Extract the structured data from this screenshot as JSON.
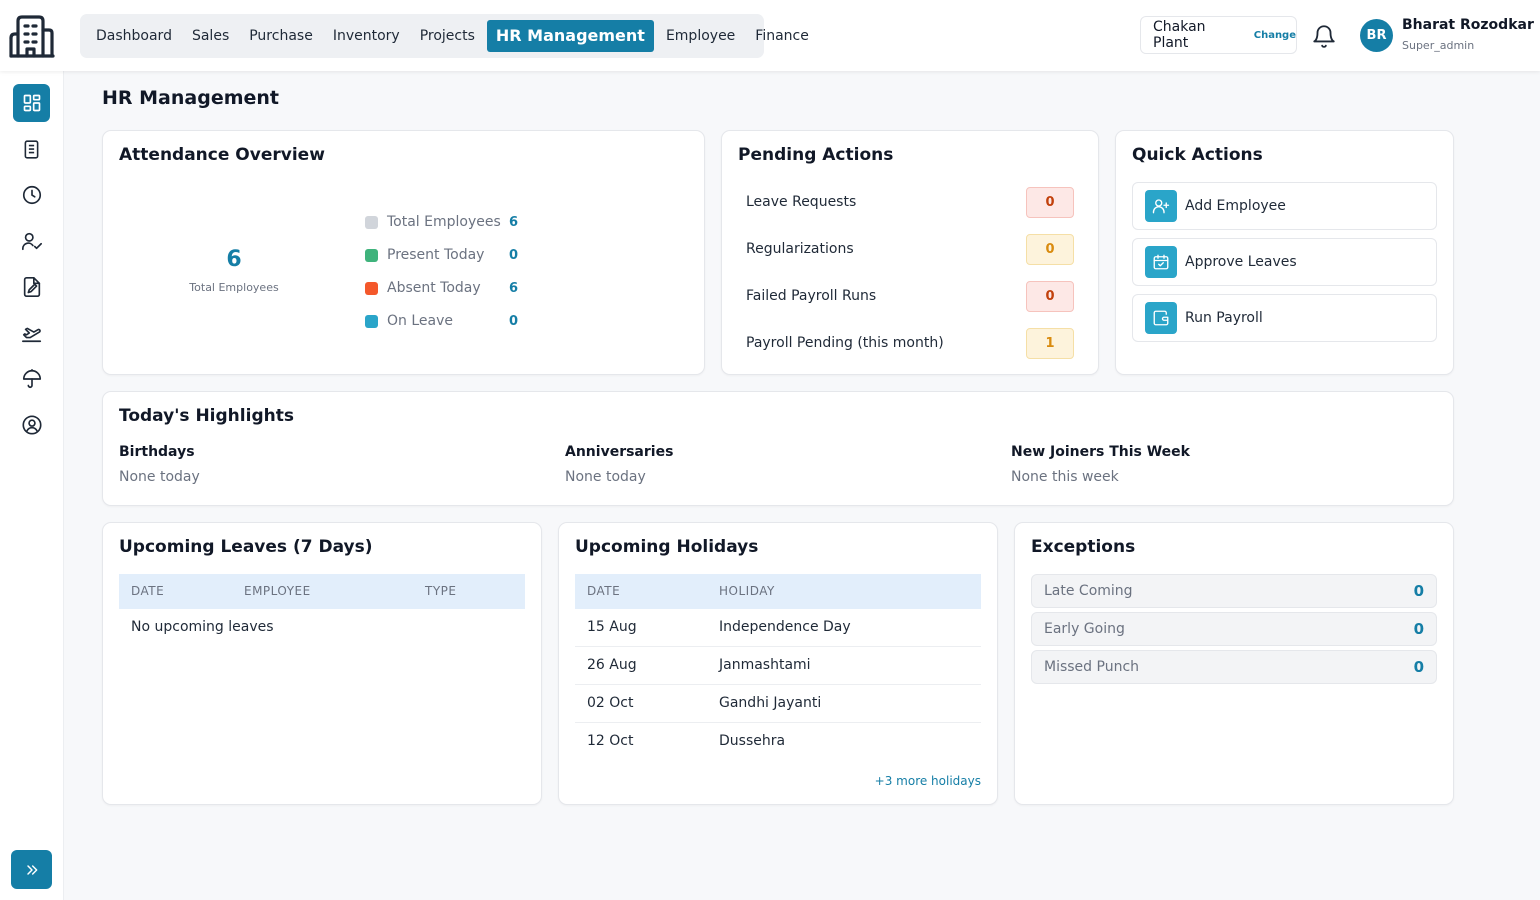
{
  "nav": {
    "items": [
      {
        "label": "Dashboard",
        "active": false
      },
      {
        "label": "Sales",
        "active": false
      },
      {
        "label": "Purchase",
        "active": false
      },
      {
        "label": "Inventory",
        "active": false
      },
      {
        "label": "Projects",
        "active": false
      },
      {
        "label": "HR Management",
        "active": true
      },
      {
        "label": "Employee",
        "active": false
      },
      {
        "label": "Finance",
        "active": false
      }
    ]
  },
  "plant": {
    "name": "Chakan Plant",
    "change_label": "Change"
  },
  "user": {
    "initials": "BR",
    "name": "Bharat Rozodkar",
    "role": "Super_admin"
  },
  "sidebar": {
    "icons": [
      "dashboard-icon",
      "document-icon",
      "clock-icon",
      "user-check-icon",
      "file-edit-icon",
      "plane-icon",
      "umbrella-icon",
      "user-circle-icon"
    ],
    "expand_icon": "chevrons-right-icon"
  },
  "page": {
    "title": "HR Management"
  },
  "attendance": {
    "title": "Attendance Overview",
    "total_value": "6",
    "total_label": "Total Employees",
    "legend": [
      {
        "label": "Total Employees",
        "value": "6",
        "color": "#d1d5db"
      },
      {
        "label": "Present Today",
        "value": "0",
        "color": "#3fb37c"
      },
      {
        "label": "Absent Today",
        "value": "6",
        "color": "#f4582b"
      },
      {
        "label": "On Leave",
        "value": "0",
        "color": "#2aa5c9"
      }
    ]
  },
  "pending": {
    "title": "Pending Actions",
    "items": [
      {
        "label": "Leave Requests",
        "value": "0",
        "tone": "red"
      },
      {
        "label": "Regularizations",
        "value": "0",
        "tone": "amber"
      },
      {
        "label": "Failed Payroll Runs",
        "value": "0",
        "tone": "red"
      },
      {
        "label": "Payroll Pending (this month)",
        "value": "1",
        "tone": "amber"
      }
    ]
  },
  "quick_actions": {
    "title": "Quick Actions",
    "items": [
      {
        "label": "Add Employee",
        "icon": "user-plus-icon"
      },
      {
        "label": "Approve Leaves",
        "icon": "calendar-check-icon"
      },
      {
        "label": "Run Payroll",
        "icon": "wallet-icon"
      }
    ]
  },
  "highlights": {
    "title": "Today's Highlights",
    "columns": [
      {
        "label": "Birthdays",
        "value": "None today"
      },
      {
        "label": "Anniversaries",
        "value": "None today"
      },
      {
        "label": "New Joiners This Week",
        "value": "None this week"
      }
    ]
  },
  "upcoming_leaves": {
    "title": "Upcoming Leaves (7 Days)",
    "headers": [
      "DATE",
      "EMPLOYEE",
      "TYPE"
    ],
    "empty_text": "No upcoming leaves"
  },
  "holidays": {
    "title": "Upcoming Holidays",
    "headers": [
      "DATE",
      "HOLIDAY"
    ],
    "rows": [
      {
        "date": "15 Aug",
        "name": "Independence Day"
      },
      {
        "date": "26 Aug",
        "name": "Janmashtami"
      },
      {
        "date": "02 Oct",
        "name": "Gandhi Jayanti"
      },
      {
        "date": "12 Oct",
        "name": "Dussehra"
      }
    ],
    "more_link": "+3 more holidays"
  },
  "exceptions": {
    "title": "Exceptions",
    "items": [
      {
        "label": "Late Coming",
        "value": "0"
      },
      {
        "label": "Early Going",
        "value": "0"
      },
      {
        "label": "Missed Punch",
        "value": "0"
      }
    ]
  },
  "colors": {
    "accent": "#157ea6",
    "accent_light": "#2aa5c9"
  }
}
